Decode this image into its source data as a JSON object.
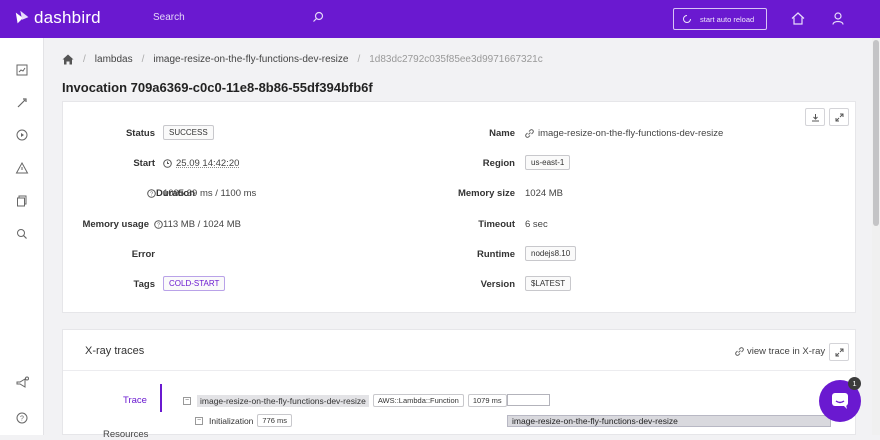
{
  "app": {
    "name": "dashbird"
  },
  "header": {
    "search_label": "Search",
    "reload_label": "start auto reload"
  },
  "breadcrumb": {
    "items": [
      "lambdas",
      "image-resize-on-the-fly-functions-dev-resize",
      "1d83dc2792c035f85ee3d9971667321c"
    ]
  },
  "page_title": "Invocation 709a6369-c0c0-11e8-8b86-55df394bfb6f",
  "details": {
    "status_label": "Status",
    "status_value": "SUCCESS",
    "start_label": "Start",
    "start_value": "25.09 14:42:20",
    "duration_label": "Duration",
    "duration_value": "1095.39 ms / 1100 ms",
    "memory_usage_label": "Memory usage",
    "memory_usage_value": "113 MB / 1024 MB",
    "error_label": "Error",
    "tags_label": "Tags",
    "tags_value": "COLD-START",
    "name_label": "Name",
    "name_value": "image-resize-on-the-fly-functions-dev-resize",
    "region_label": "Region",
    "region_value": "us-east-1",
    "memory_size_label": "Memory size",
    "memory_size_value": "1024 MB",
    "timeout_label": "Timeout",
    "timeout_value": "6 sec",
    "runtime_label": "Runtime",
    "runtime_value": "nodejs8.10",
    "version_label": "Version",
    "version_value": "$LATEST"
  },
  "xray": {
    "title": "X-ray traces",
    "view_link": "view trace in X-ray",
    "tabs": {
      "trace": "Trace",
      "resources": "Resources"
    },
    "tree": {
      "root_name": "image-resize-on-the-fly-functions-dev-resize",
      "root_type": "AWS::Lambda::Function",
      "root_duration": "1079 ms",
      "child_name": "Initialization",
      "child_duration": "776 ms",
      "bar_label": "image-resize-on-the-fly-functions-dev-resize"
    }
  },
  "chat": {
    "badge_count": "1"
  },
  "colors": {
    "brand": "#6a19d0",
    "background": "#f2f2f4"
  }
}
